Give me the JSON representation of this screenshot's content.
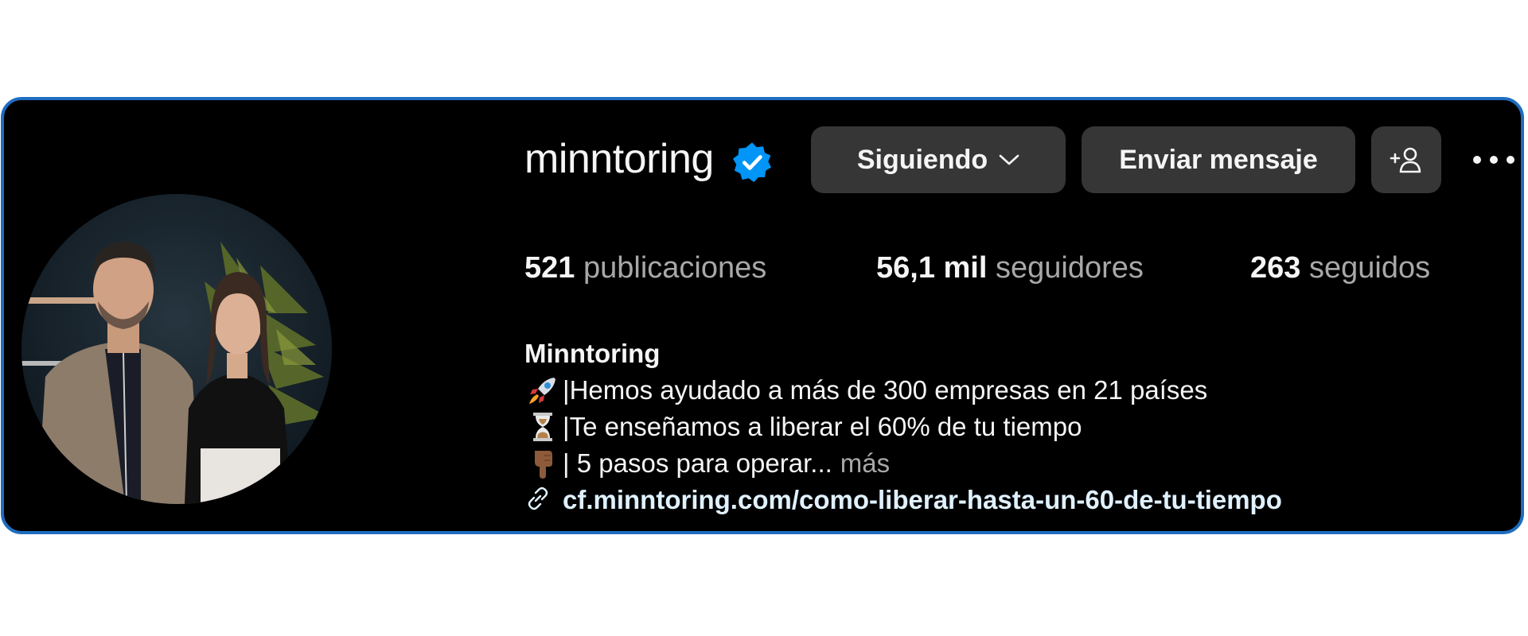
{
  "profile": {
    "username": "minntoring",
    "verified": true,
    "avatar_alt": "profile-photo",
    "colors": {
      "background": "#000000",
      "frame_border": "#1e6dc0",
      "verified_badge": "#0095f6",
      "button_bg": "#363636",
      "link": "#e0f1ff",
      "muted": "#a8a8a8"
    }
  },
  "actions": {
    "follow_label": "Siguiendo",
    "message_label": "Enviar mensaje",
    "suggest_icon": "add-person-icon",
    "more_icon": "more-options-icon"
  },
  "stats": {
    "posts_count": "521",
    "posts_label": "publicaciones",
    "followers_count": "56,1 mil",
    "followers_label": "seguidores",
    "following_count": "263",
    "following_label": "seguidos"
  },
  "bio": {
    "name": "Minntoring",
    "lines": [
      {
        "emoji": "rocket-emoji",
        "text": "|Hemos ayudado a más de 300 empresas en 21 países"
      },
      {
        "emoji": "hourglass-emoji",
        "text": "|Te enseñamos a liberar el 60% de tu tiempo"
      },
      {
        "emoji": "pointing-down-emoji",
        "text": "| 5 pasos para operar..."
      }
    ],
    "more_label": "más",
    "link_icon": "link-icon",
    "link": "cf.minntoring.com/como-liberar-hasta-un-60-de-tu-tiempo"
  }
}
